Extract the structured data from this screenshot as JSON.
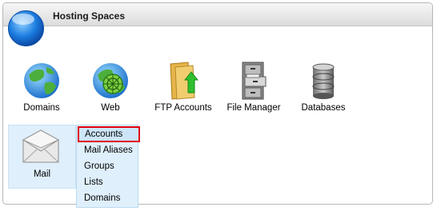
{
  "panel": {
    "title": "Hosting Spaces"
  },
  "tiles": [
    {
      "label": "Domains",
      "icon": "globe-icon"
    },
    {
      "label": "Web",
      "icon": "web-globe-icon"
    },
    {
      "label": "FTP Accounts",
      "icon": "folder-upload-icon"
    },
    {
      "label": "File Manager",
      "icon": "file-cabinet-icon"
    },
    {
      "label": "Databases",
      "icon": "database-icon"
    }
  ],
  "mail": {
    "label": "Mail",
    "icon": "envelope-icon"
  },
  "mail_menu": {
    "items": [
      "Accounts",
      "Mail Aliases",
      "Groups",
      "Lists",
      "Domains"
    ],
    "highlighted": "Accounts"
  },
  "colors": {
    "highlight_border": "#e2000f",
    "menu_bg": "#dff0fc"
  }
}
